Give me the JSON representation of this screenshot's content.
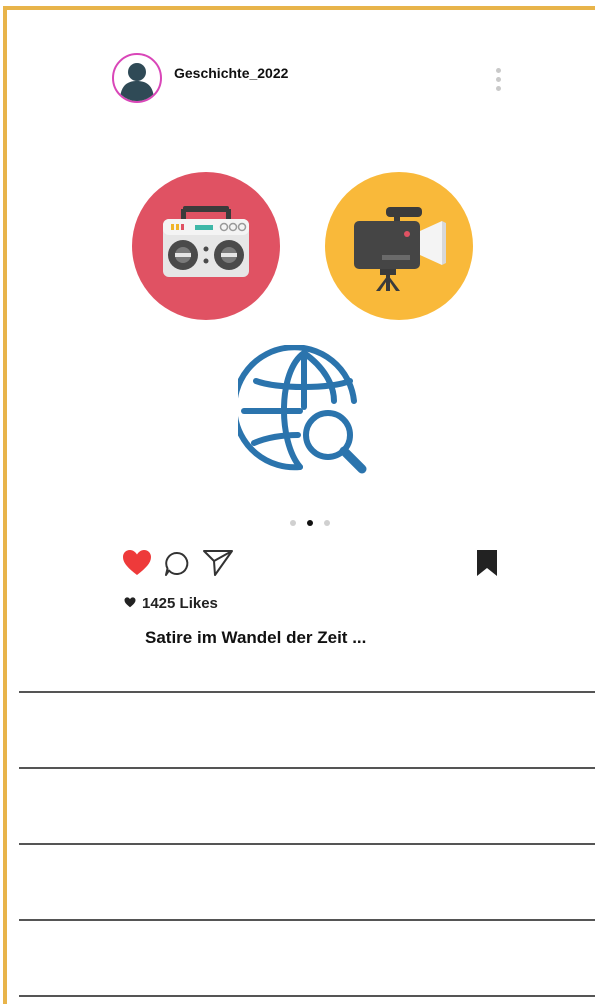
{
  "post": {
    "username": "Geschichte_2022",
    "likes_text": "1425 Likes",
    "caption": "Satire im Wandel der Zeit ..."
  },
  "carousel": {
    "slide_count": 3,
    "active_index": 1
  },
  "colors": {
    "frame_border": "#e8b44a",
    "avatar_ring": "#d946b8",
    "like_heart": "#ee3a3a",
    "radio_circle": "#e05263",
    "camera_circle": "#f9b93a",
    "globe_blue": "#2b74ad"
  },
  "icons": {
    "avatar": "user-silhouette-icon",
    "more": "more-vertical-icon",
    "media_1": "radio-boombox-icon",
    "media_2": "video-camera-icon",
    "media_3": "globe-search-icon",
    "like": "heart-icon",
    "comment": "comment-icon",
    "share": "send-icon",
    "save": "bookmark-icon"
  },
  "notes": {
    "writing_lines": 5
  }
}
